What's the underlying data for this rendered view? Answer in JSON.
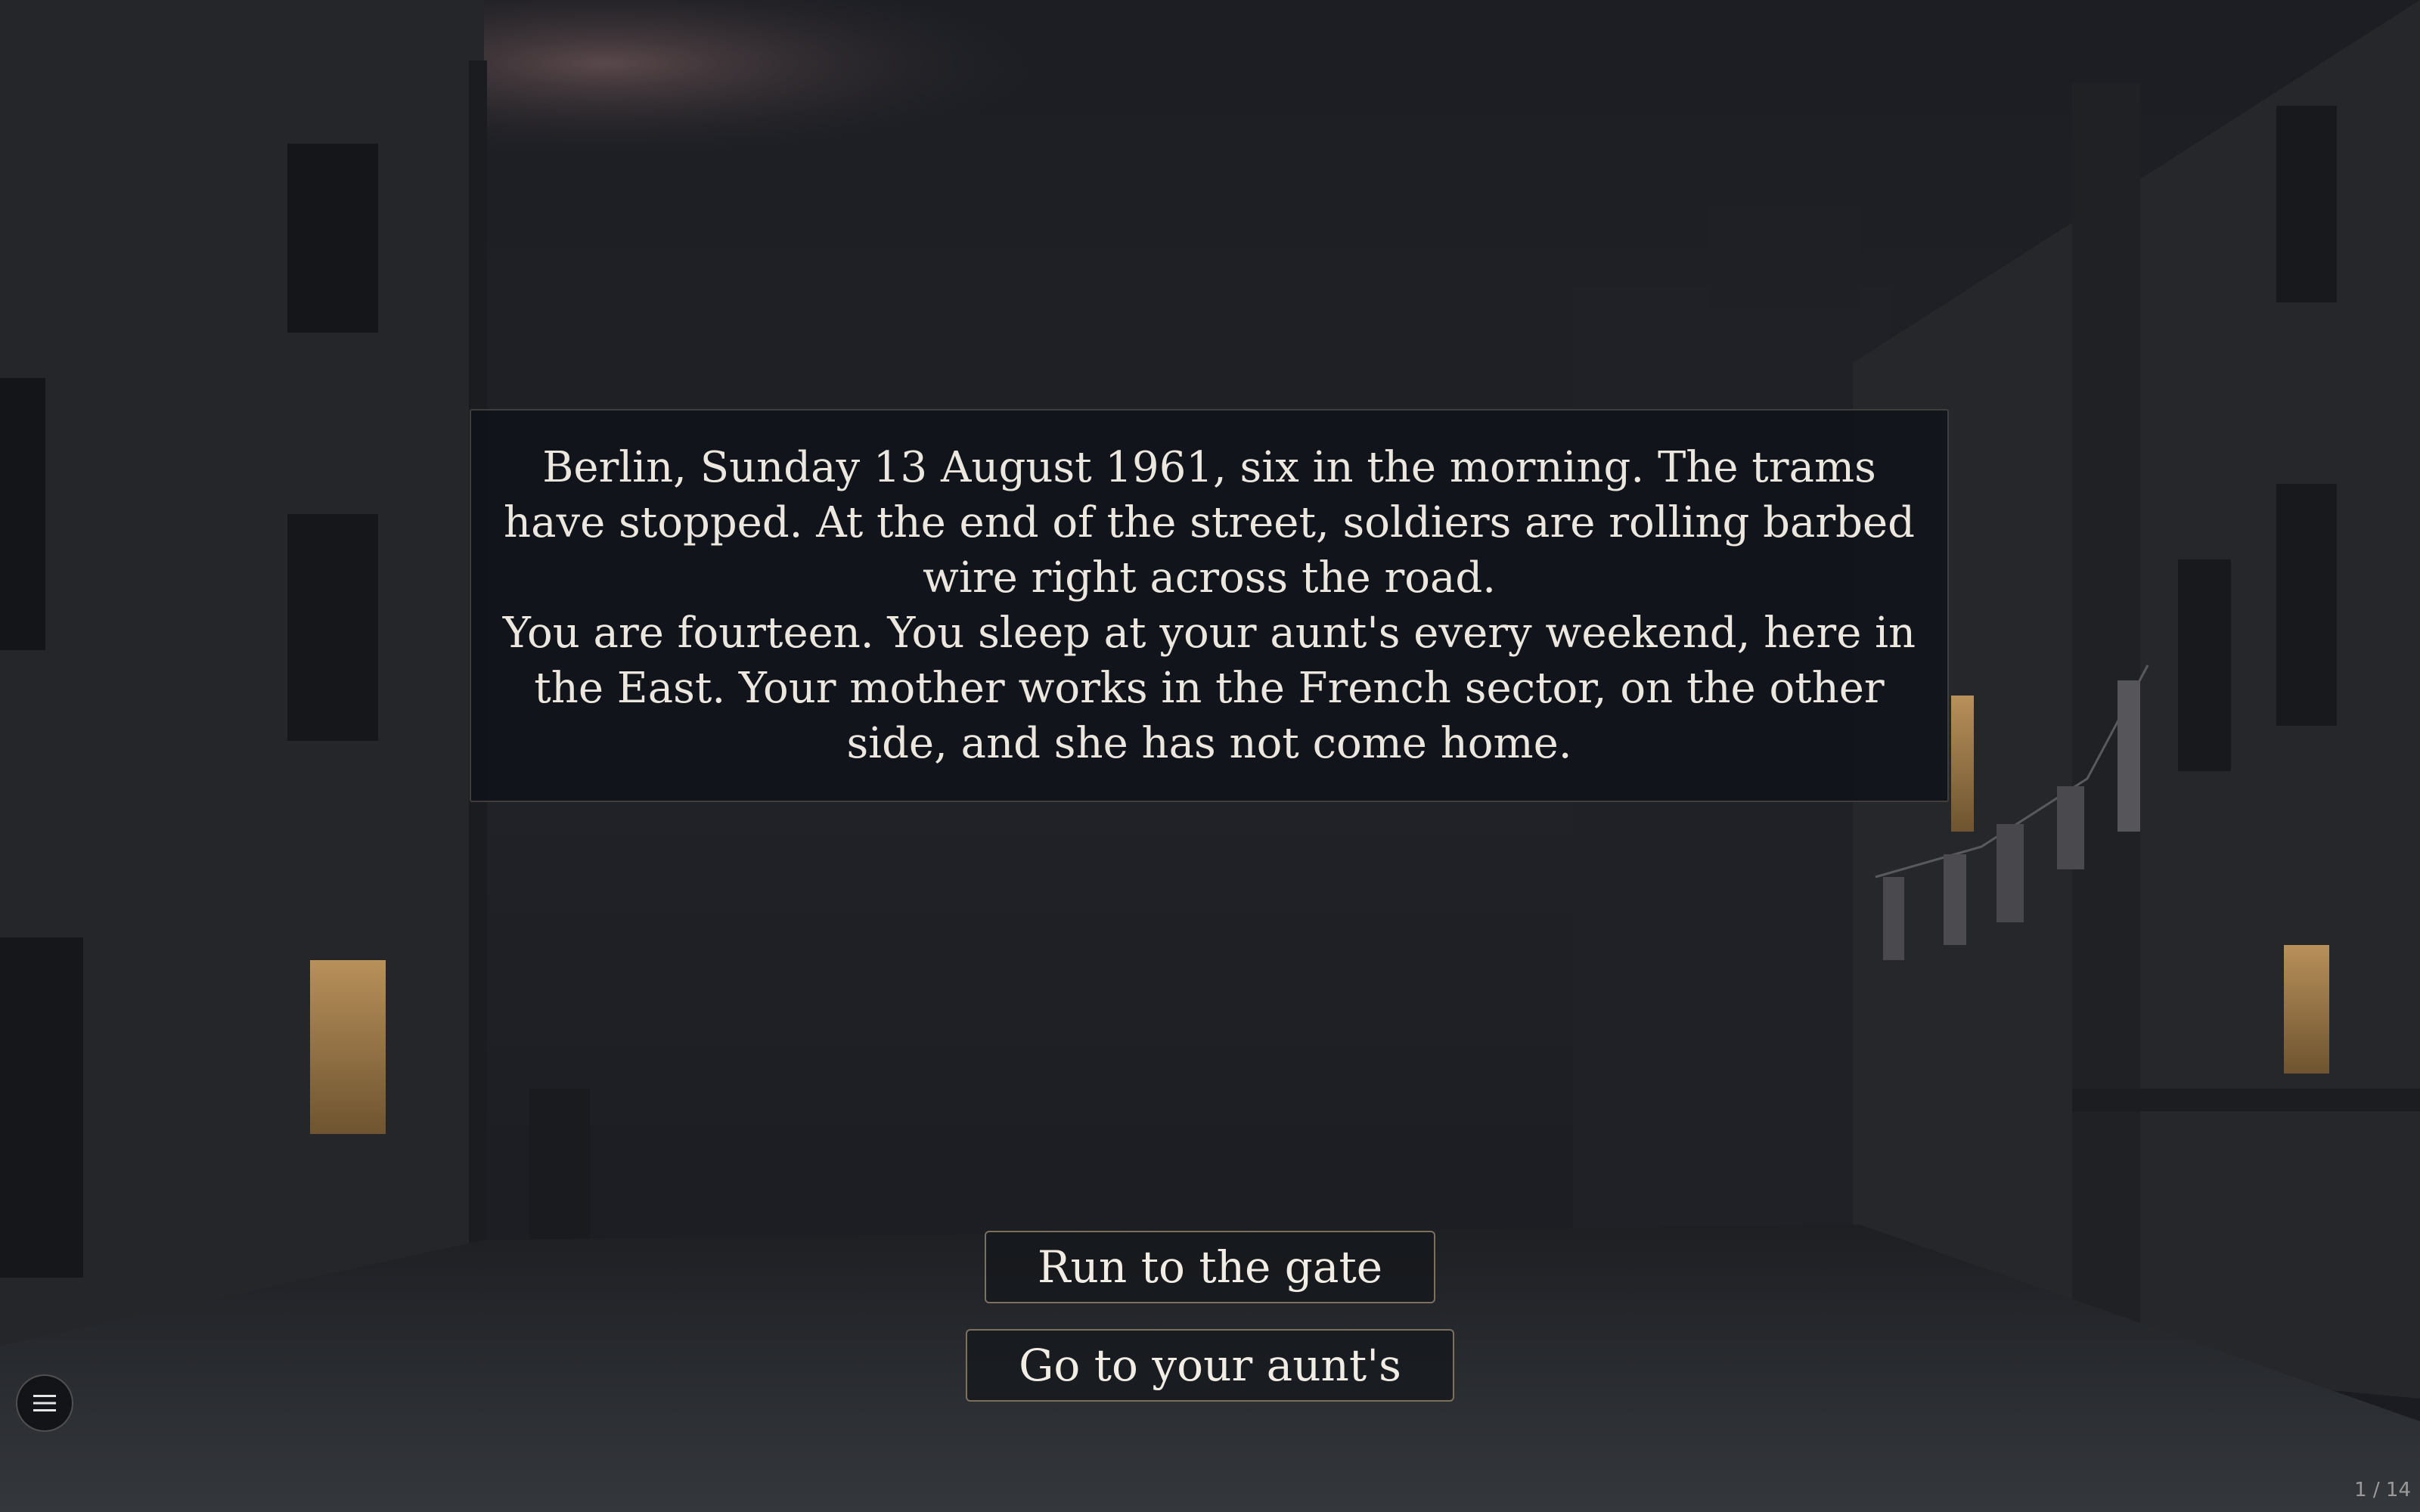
{
  "scene": {
    "background_description_icon": "night-street-background",
    "narration": {
      "paragraph_1": "Berlin, Sunday 13 August 1961, six in the morning. The trams have stopped. At the end of the street, soldiers are rolling barbed wire right across the road.",
      "paragraph_2": "You are fourteen. You sleep at your aunt's every weekend, here in the East. Your mother works in the French sector, on the other side, and she has not come home."
    },
    "choices": [
      {
        "label": "Run to the gate"
      },
      {
        "label": "Go to your aunt's"
      }
    ],
    "menu": {
      "icon": "hamburger-menu-icon"
    },
    "page_counter": "1 / 14"
  },
  "colors": {
    "panel_bg": "#0f131a",
    "panel_border": "#786f60",
    "text": "#ebe7de",
    "button_border": "#aa9678"
  }
}
